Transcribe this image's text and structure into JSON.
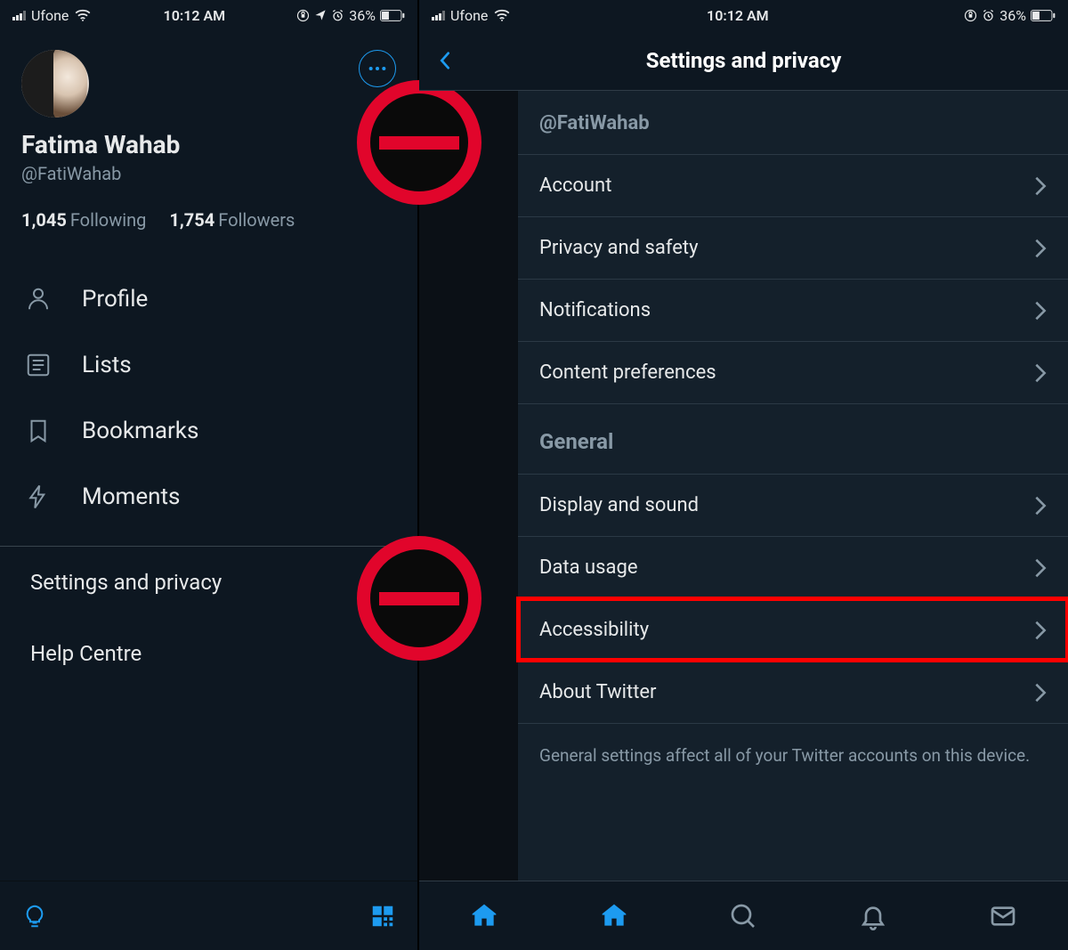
{
  "status_bar": {
    "carrier": "Ufone",
    "time": "10:12 AM",
    "battery_pct": "36%"
  },
  "drawer": {
    "display_name": "Fatima Wahab",
    "handle": "@FatiWahab",
    "following_count": "1,045",
    "following_label": "Following",
    "followers_count": "1,754",
    "followers_label": "Followers",
    "nav": [
      {
        "icon": "person",
        "label": "Profile"
      },
      {
        "icon": "list",
        "label": "Lists"
      },
      {
        "icon": "bookmark",
        "label": "Bookmarks"
      },
      {
        "icon": "moment",
        "label": "Moments"
      }
    ],
    "footer_links": [
      "Settings and privacy",
      "Help Centre"
    ]
  },
  "settings": {
    "title": "Settings and privacy",
    "handle": "@FatiWahab",
    "account_section": [
      "Account",
      "Privacy and safety",
      "Notifications",
      "Content preferences"
    ],
    "general_header": "General",
    "general_section": [
      "Display and sound",
      "Data usage",
      "Accessibility",
      "About Twitter"
    ],
    "highlight_index": 2,
    "footer_note": "General settings affect all of your Twitter accounts on this device."
  }
}
